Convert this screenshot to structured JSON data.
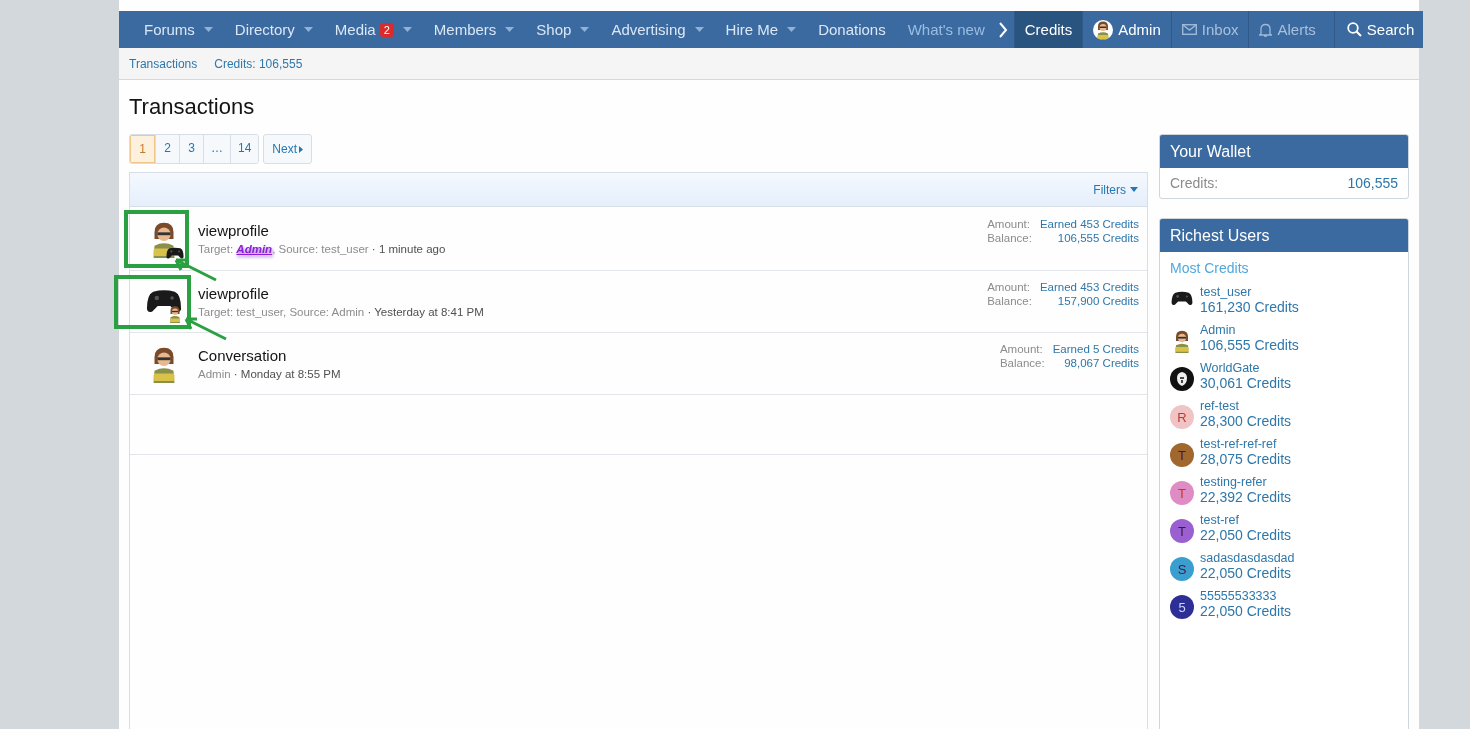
{
  "nav": {
    "items": [
      {
        "label": "Forums",
        "dropdown": true
      },
      {
        "label": "Directory",
        "dropdown": true
      },
      {
        "label": "Media",
        "dropdown": true,
        "badge": "2"
      },
      {
        "label": "Members",
        "dropdown": true
      },
      {
        "label": "Shop",
        "dropdown": true
      },
      {
        "label": "Advertising",
        "dropdown": true
      },
      {
        "label": "Hire Me",
        "dropdown": true
      },
      {
        "label": "Donations",
        "dropdown": false
      },
      {
        "label": "What's new",
        "dropdown": false
      }
    ],
    "right": [
      {
        "label": "Credits",
        "kind": "link",
        "selected": true
      },
      {
        "label": "Admin",
        "kind": "user",
        "selected": false
      },
      {
        "label": "Inbox",
        "kind": "inbox",
        "selected": false
      },
      {
        "label": "Alerts",
        "kind": "alerts",
        "selected": false
      },
      {
        "label": "Search",
        "kind": "search",
        "selected": false
      }
    ]
  },
  "subnav": [
    "Transactions",
    "Credits: 106,555"
  ],
  "title": "Transactions",
  "pager": {
    "pages": [
      {
        "label": "1",
        "selected": true
      },
      {
        "label": "2",
        "selected": false
      },
      {
        "label": "3",
        "selected": false
      },
      {
        "label": "…",
        "selected": false
      },
      {
        "label": "14",
        "selected": false
      }
    ],
    "next": "Next"
  },
  "filters": "Filters",
  "transactions": [
    {
      "title": "viewprofile",
      "avatar": {
        "kind": "cartoon"
      },
      "overlay": {
        "kind": "controller"
      },
      "annotated": true,
      "meta": [
        {
          "text": "Target: ",
          "kind": "plain"
        },
        {
          "text": "Admin",
          "kind": "highlight"
        },
        {
          "text": ", Source: test_user",
          "kind": "plain"
        },
        {
          "text": " · 1 minute ago",
          "kind": "time"
        }
      ],
      "amount_label": "Amount:",
      "amount": "Earned 453 Credits",
      "balance_label": "Balance:",
      "balance": "106,555 Credits"
    },
    {
      "title": "viewprofile",
      "avatar": {
        "kind": "controller"
      },
      "overlay": {
        "kind": "cartoon"
      },
      "annotated": true,
      "meta": [
        {
          "text": "Target: test_user, Source: Admin",
          "kind": "plain"
        },
        {
          "text": " · Yesterday at 8:41 PM",
          "kind": "time"
        }
      ],
      "amount_label": "Amount:",
      "amount": "Earned 453 Credits",
      "balance_label": "Balance:",
      "balance": "157,900 Credits"
    },
    {
      "title": "Conversation",
      "avatar": {
        "kind": "cartoon"
      },
      "annotated": false,
      "meta": [
        {
          "text": "Admin",
          "kind": "plain"
        },
        {
          "text": " · Monday at 8:55 PM",
          "kind": "time"
        }
      ],
      "amount_label": "Amount:",
      "amount": "Earned 5 Credits",
      "balance_label": "Balance:",
      "balance": "98,067 Credits"
    }
  ],
  "wallet": {
    "title": "Your Wallet",
    "label": "Credits:",
    "value": "106,555"
  },
  "richest": {
    "title": "Richest Users",
    "subtitle": "Most Credits",
    "users": [
      {
        "name": "test_user",
        "credits": "161,230 Credits",
        "avatar": {
          "kind": "controller"
        }
      },
      {
        "name": "Admin",
        "credits": "106,555 Credits",
        "avatar": {
          "kind": "cartoon"
        }
      },
      {
        "name": "WorldGate",
        "credits": "30,061 Credits",
        "avatar": {
          "kind": "lion"
        }
      },
      {
        "name": "ref-test",
        "credits": "28,300 Credits",
        "avatar": {
          "kind": "letter",
          "letter": "R",
          "color": "#f0c4c4"
        }
      },
      {
        "name": "test-ref-ref-ref",
        "credits": "28,075 Credits",
        "avatar": {
          "kind": "letter",
          "letter": "T",
          "color": "#a0672e"
        }
      },
      {
        "name": "testing-refer",
        "credits": "22,392 Credits",
        "avatar": {
          "kind": "letter",
          "letter": "T",
          "color": "#e08cc4"
        }
      },
      {
        "name": "test-ref",
        "credits": "22,050 Credits",
        "avatar": {
          "kind": "letter",
          "letter": "T",
          "color": "#9a5fd1"
        }
      },
      {
        "name": "sadasdasdasdad",
        "credits": "22,050 Credits",
        "avatar": {
          "kind": "letter",
          "letter": "S",
          "color": "#3a9fcf"
        }
      },
      {
        "name": "55555533333",
        "credits": "22,050 Credits",
        "avatar": {
          "kind": "letter",
          "letter": "5",
          "color": "#2e2f96"
        }
      }
    ]
  }
}
